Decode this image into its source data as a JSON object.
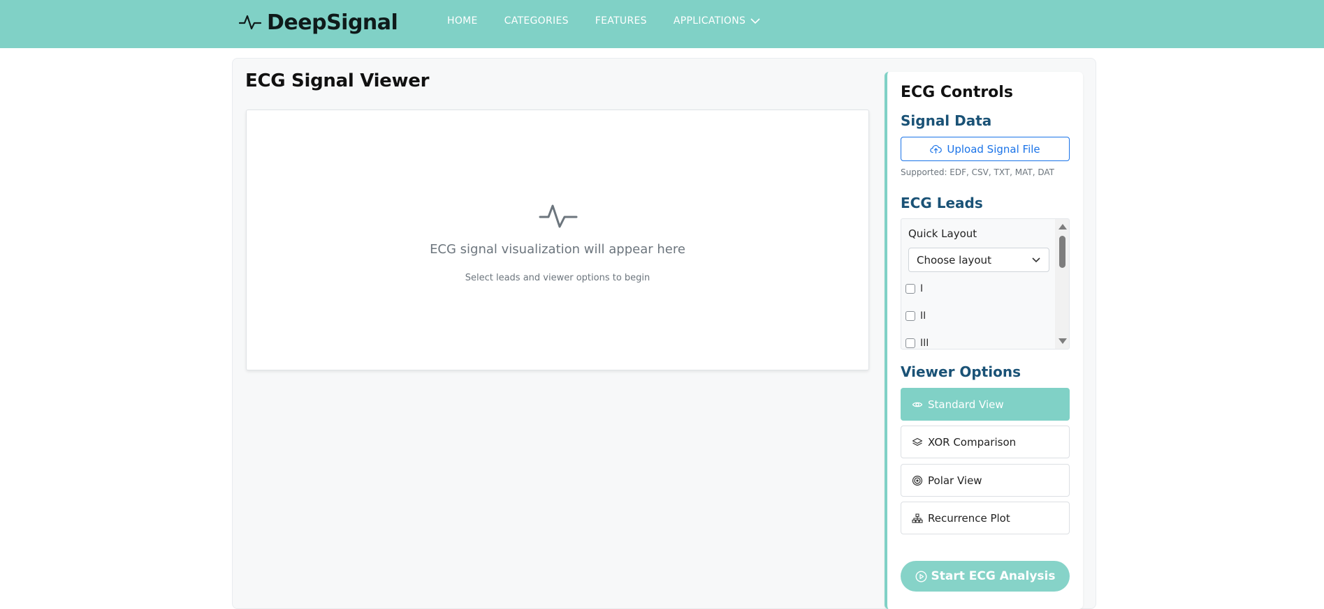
{
  "brand": {
    "name": "DeepSignal",
    "icon": "pulse-icon"
  },
  "nav": {
    "items": [
      {
        "label": "HOME"
      },
      {
        "label": "CATEGORIES"
      },
      {
        "label": "FEATURES"
      },
      {
        "label": "APPLICATIONS",
        "icon": "chevron-down-icon"
      }
    ]
  },
  "colors": {
    "accent": "#80d1c6",
    "heading_blue": "#1a5276",
    "link_blue": "#1a73e8"
  },
  "viewer": {
    "title": "ECG Signal Viewer",
    "icon": "pulse-icon",
    "placeholder": "ECG signal visualization will appear here",
    "hint": "Select leads and viewer options to begin"
  },
  "controls": {
    "title": "ECG Controls",
    "signal_data": {
      "heading": "Signal Data",
      "upload_label": "Upload Signal File",
      "upload_icon": "cloud-upload-icon",
      "supported": "Supported: EDF, CSV, TXT, MAT, DAT"
    },
    "leads": {
      "heading": "ECG Leads",
      "quick_layout_label": "Quick Layout",
      "layout_select_value": "Choose layout",
      "items": [
        {
          "label": "I",
          "checked": false
        },
        {
          "label": "II",
          "checked": false
        },
        {
          "label": "III",
          "checked": false
        }
      ]
    },
    "viewer_options": {
      "heading": "Viewer Options",
      "options": [
        {
          "label": "Standard View",
          "icon": "eye-icon",
          "active": true
        },
        {
          "label": "XOR Comparison",
          "icon": "layers-icon",
          "active": false
        },
        {
          "label": "Polar View",
          "icon": "target-icon",
          "active": false
        },
        {
          "label": "Recurrence Plot",
          "icon": "hierarchy-icon",
          "active": false
        }
      ]
    },
    "start_label": "Start ECG Analysis",
    "start_icon": "play-circle-icon"
  }
}
